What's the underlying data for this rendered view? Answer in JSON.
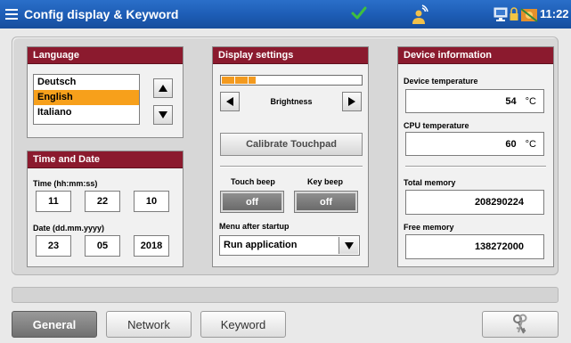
{
  "titlebar": {
    "title": "Config display & Keyword",
    "clock": "11:22",
    "icons": [
      "menu-icon",
      "check-icon",
      "user-icon",
      "monitor-icon",
      "lock-icon",
      "network-icon"
    ]
  },
  "language": {
    "header": "Language",
    "items": [
      "Deutsch",
      "English",
      "Italiano"
    ],
    "selected": "English"
  },
  "time_date": {
    "header": "Time and Date",
    "time_label": "Time (hh:mm:ss)",
    "hours": "11",
    "minutes": "22",
    "seconds": "10",
    "date_label": "Date (dd.mm.yyyy)",
    "day": "23",
    "month": "05",
    "year": "2018"
  },
  "display": {
    "header": "Display settings",
    "brightness_label": "Brightness",
    "brightness_level": 0.25,
    "calibrate_label": "Calibrate Touchpad",
    "touch_beep_label": "Touch beep",
    "touch_beep_value": "off",
    "key_beep_label": "Key beep",
    "key_beep_value": "off",
    "menu_label": "Menu after startup",
    "menu_value": "Run application"
  },
  "device": {
    "header": "Device information",
    "device_temp_label": "Device temperature",
    "device_temp_value": "54",
    "cpu_temp_label": "CPU temperature",
    "cpu_temp_value": "60",
    "temp_unit": "°C",
    "total_mem_label": "Total memory",
    "total_mem_value": "208290224",
    "free_mem_label": "Free memory",
    "free_mem_value": "138272000"
  },
  "tabs": {
    "general": "General",
    "network": "Network",
    "keyword": "Keyword",
    "active": "General"
  },
  "colors": {
    "titlebar": "#1d5cb4",
    "panel_header": "#8b1a2e",
    "selection": "#f7a01b",
    "brightness_fill": "#f39a1f"
  }
}
